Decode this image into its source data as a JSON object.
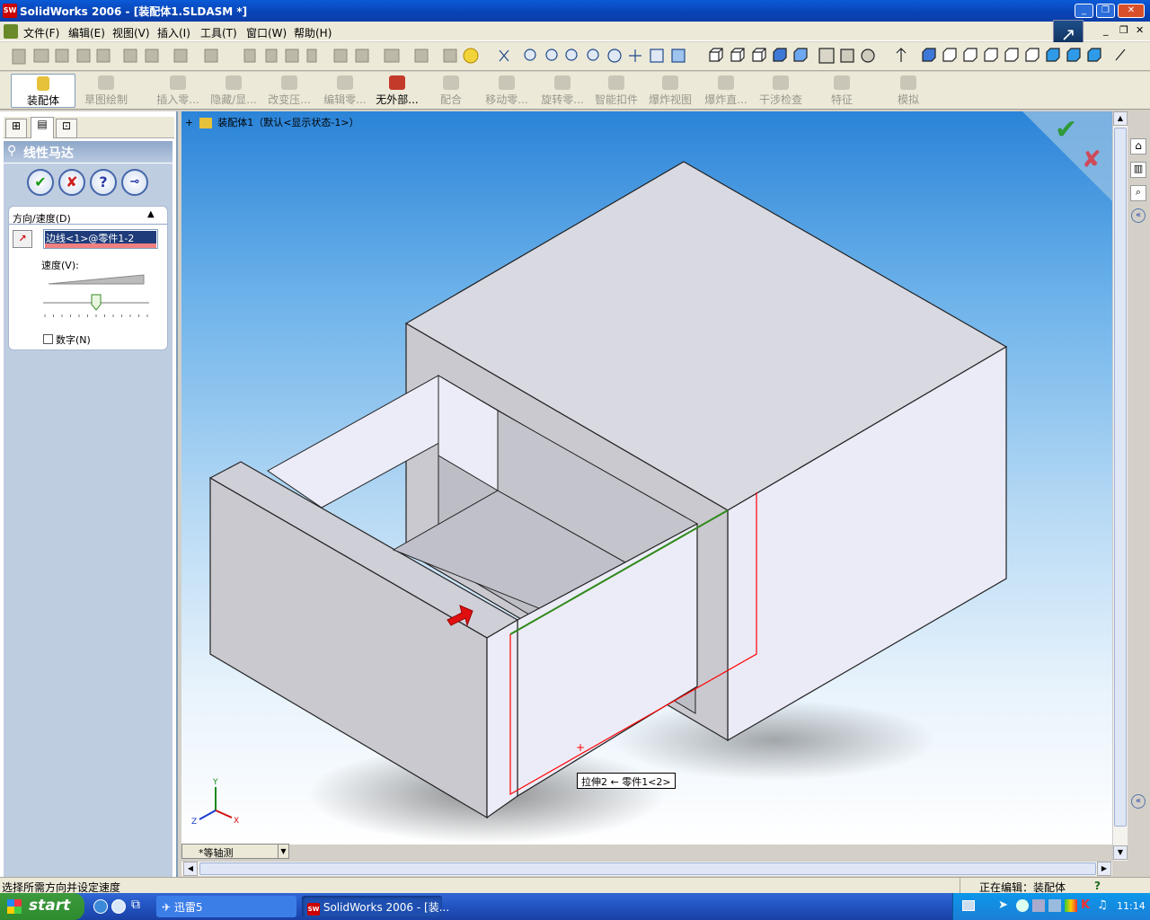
{
  "app": {
    "title": "SolidWorks 2006 - [装配体1.SLDASM *]",
    "logo": "SW"
  },
  "menubar": {
    "items": [
      "文件(F)",
      "编辑(E)",
      "视图(V)",
      "插入(I)",
      "工具(T)",
      "窗口(W)",
      "帮助(H)"
    ]
  },
  "command_manager": {
    "active": "装配体",
    "items": [
      "草图绘制",
      "插入零...",
      "隐藏/显...",
      "改变压...",
      "编辑零...",
      "无外部...",
      "配合",
      "移动零...",
      "旋转零...",
      "智能扣件",
      "爆炸视图",
      "爆炸直...",
      "干涉检查",
      "特征",
      "模拟"
    ]
  },
  "tree": {
    "root_label": "装配体1（默认<显示状态-1>）"
  },
  "property_manager": {
    "title": "线性马达",
    "ok_icon": "check-icon",
    "cancel_icon": "x-icon",
    "help_icon": "question-icon",
    "pin_icon": "pushpin-icon",
    "group_title": "方向/速度(D)",
    "direction_value": "边线<1>@零件1-2",
    "speed_label": "速度(V):",
    "speed_level": 0.5,
    "numeric_label": "数字(N)",
    "numeric_checked": false
  },
  "viewport": {
    "tooltip": "拉伸2 ← 零件1<2>",
    "view_orientation": "*等轴测",
    "triad": {
      "x": "X",
      "y": "Y",
      "z": "Z"
    }
  },
  "status": {
    "left": "选择所需方向并设定速度",
    "right": "正在编辑：装配体",
    "help": "?"
  },
  "taskbar": {
    "start": "start",
    "tasks": [
      "迅雷5",
      "SolidWorks 2006 - [装..."
    ],
    "clock": "11:14"
  },
  "colors": {
    "accent": "#0a5ad6",
    "highlight_edge": "#2f8a1a",
    "selection": "#ff0000",
    "motor_arrow": "#e01010"
  }
}
